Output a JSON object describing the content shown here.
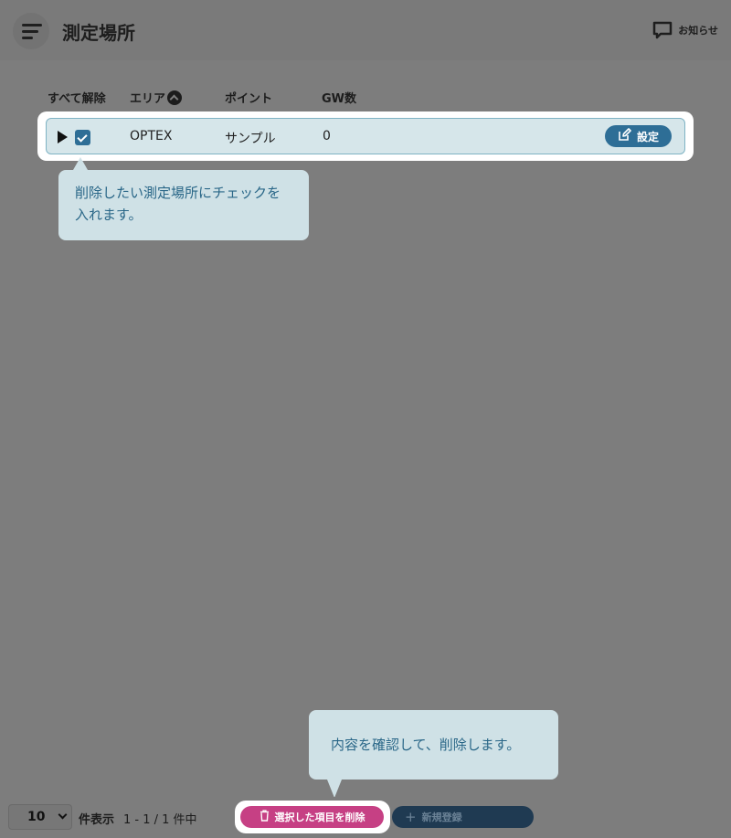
{
  "header": {
    "title": "測定場所",
    "notice_label": "お知らせ"
  },
  "table": {
    "columns": {
      "select_all": "すべて解除",
      "area": "エリア",
      "point": "ポイント",
      "gw_count": "GW数"
    },
    "rows": [
      {
        "area": "OPTEX",
        "point": "サンプル",
        "gw_count": "0",
        "checked": true,
        "settings_label": "設定"
      }
    ]
  },
  "callouts": {
    "check_hint": "削除したい測定場所にチェックを入れます。",
    "delete_hint": "内容を確認して、削除します。"
  },
  "footer": {
    "per_page_value": "10",
    "per_page_label": "件表示",
    "pagination": "1 - 1 / 1 件中",
    "delete_label": "選択した項目を削除",
    "new_label": "新規登録"
  },
  "colors": {
    "primary": "#2e6e96",
    "danger": "#c64084",
    "callout_bg": "#cfe1e6",
    "overlay": "#7d7d7d"
  }
}
